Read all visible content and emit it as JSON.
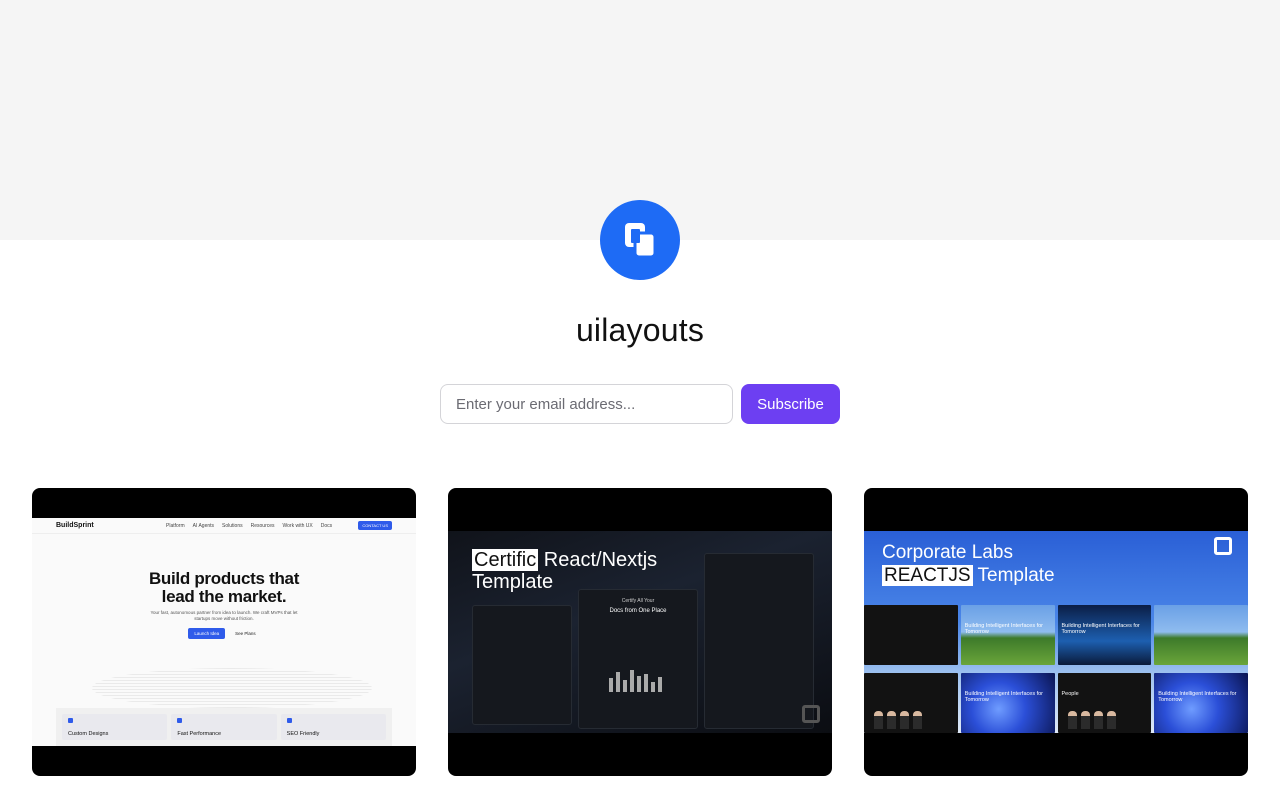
{
  "profile": {
    "name": "uilayouts",
    "avatar_icon": "copy-squares-icon",
    "brand_color": "#1e6bf5"
  },
  "subscribe": {
    "placeholder": "Enter your email address...",
    "button_label": "Subscribe",
    "button_color": "#6d3ff2"
  },
  "cards": [
    {
      "nav_logo": "BuildSprint",
      "nav_links": [
        "Platform",
        "AI Agents",
        "Solutions",
        "Resources",
        "Work with UX",
        "Docs"
      ],
      "nav_cta": "CONTACT US",
      "headline_1": "Build products that",
      "headline_2": "lead the market.",
      "paragraph": "Your fast, autonomous partner from idea to launch. We craft MVPs that let startups move without friction.",
      "primary_btn": "Launch Idea",
      "secondary_btn": "See Plans",
      "features": [
        "Custom Designs",
        "Fast Performance",
        "SEO Friendly"
      ]
    },
    {
      "title_highlight": "Certific",
      "title_rest": "React/Nextjs",
      "title_line2": "Template",
      "panel_small": "Certify All Your",
      "panel_big": "Docs from One Place"
    },
    {
      "title_line1": "Corporate Labs",
      "title_highlight": "REACTJS",
      "title_rest": "Template",
      "tile_text": "Building Intelligent Interfaces for Tomorrow",
      "people_label": "People"
    }
  ]
}
